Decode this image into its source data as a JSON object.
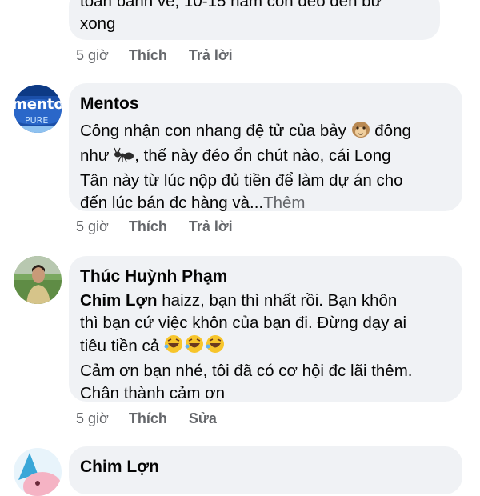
{
  "comments": [
    {
      "text_tail": "toàn bánh vẽ, 10-15 năm còn đéo đến bữ",
      "text_tail2": "xong",
      "time": "5 giờ",
      "like": "Thích",
      "reply": "Trả lời"
    },
    {
      "author": "Mentos",
      "avatar_icon": "mentos-pack-avatar",
      "line1": "Công nhận con nhang đệ tử của bảy",
      "line1_end": "đông",
      "line2_start": "như",
      "line2_end": ", thế này đéo ổn chút nào, cái Long",
      "line3": "Tân này từ lúc nộp đủ tiền để làm dự án cho",
      "line4": "đến lúc bán đc hàng và...",
      "see_more": "Thêm",
      "time": "5 giờ",
      "like": "Thích",
      "reply": "Trả lời"
    },
    {
      "author": "Thúc Huỳnh Phạm",
      "avatar_icon": "person-photo-avatar",
      "mention": "Chim Lợn",
      "line1": " haizz, bạn thì nhất rồi. Bạn khôn",
      "line2": "thì bạn cứ việc khôn của bạn đi. Đừng dạy ai",
      "line3": "tiêu tiền cả",
      "line4": "Cảm ơn bạn nhé, tôi đã có cơ hội đc lãi thêm.",
      "line5": "Chân thành cảm ơn",
      "time": "5 giờ",
      "like": "Thích",
      "edit": "Sửa"
    },
    {
      "author": "Chim Lợn",
      "avatar_icon": "pink-cartoon-avatar"
    }
  ],
  "colors": {
    "bubble": "#f0f2f5",
    "meta": "#65676b",
    "text": "#050505"
  },
  "icons": {
    "monkey": "monkey-face-emoji",
    "ant": "ant-emoji",
    "laugh": "rolling-laughing-emoji"
  }
}
